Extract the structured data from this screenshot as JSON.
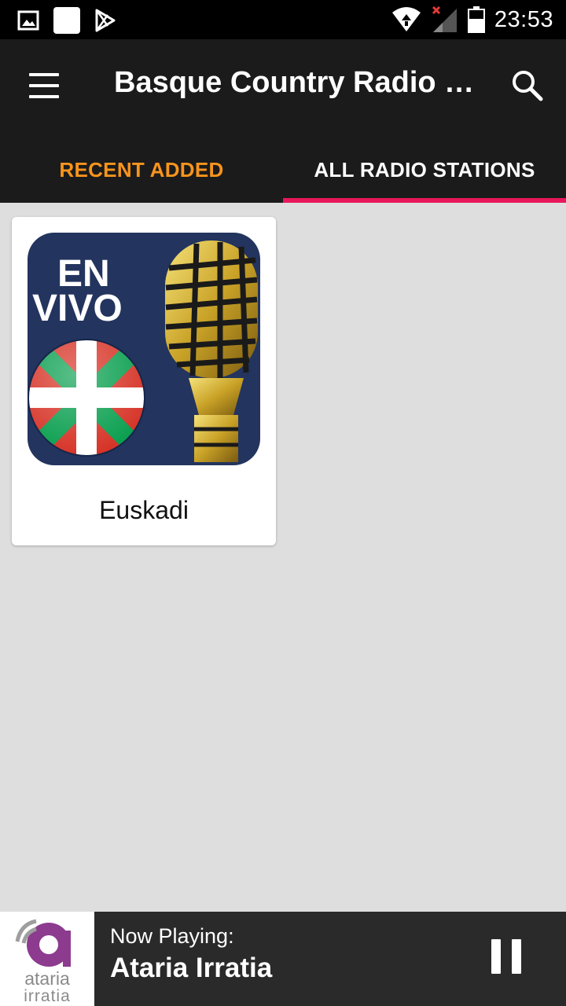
{
  "status_bar": {
    "time": "23:53",
    "icons_left": [
      "gallery-icon",
      "app-square-icon",
      "play-store-icon"
    ],
    "icons_right": [
      "wifi-icon",
      "signal-icon",
      "battery-icon"
    ]
  },
  "app_bar": {
    "title": "Basque Country Radio Stations",
    "menu_icon": "hamburger-menu-icon",
    "search_icon": "search-icon"
  },
  "tabs": [
    {
      "label": "RECENT ADDED",
      "active": false
    },
    {
      "label": "ALL RADIO STATIONS",
      "active": true
    }
  ],
  "colors": {
    "tab_highlight": "#f7941d",
    "tab_indicator": "#e8185a",
    "app_bar_bg": "#1b1b1b",
    "content_bg": "#dedede"
  },
  "stations": [
    {
      "name": "Euskadi",
      "logo": {
        "line1": "EN",
        "line2": "VIVO",
        "flag": "ikurrina-flag",
        "icon": "golden-microphone-icon"
      }
    }
  ],
  "now_playing": {
    "label": "Now Playing:",
    "station": "Ataria Irratia",
    "logo_line1": "ataria",
    "logo_line2": "irratia",
    "control_icon": "pause-icon"
  }
}
